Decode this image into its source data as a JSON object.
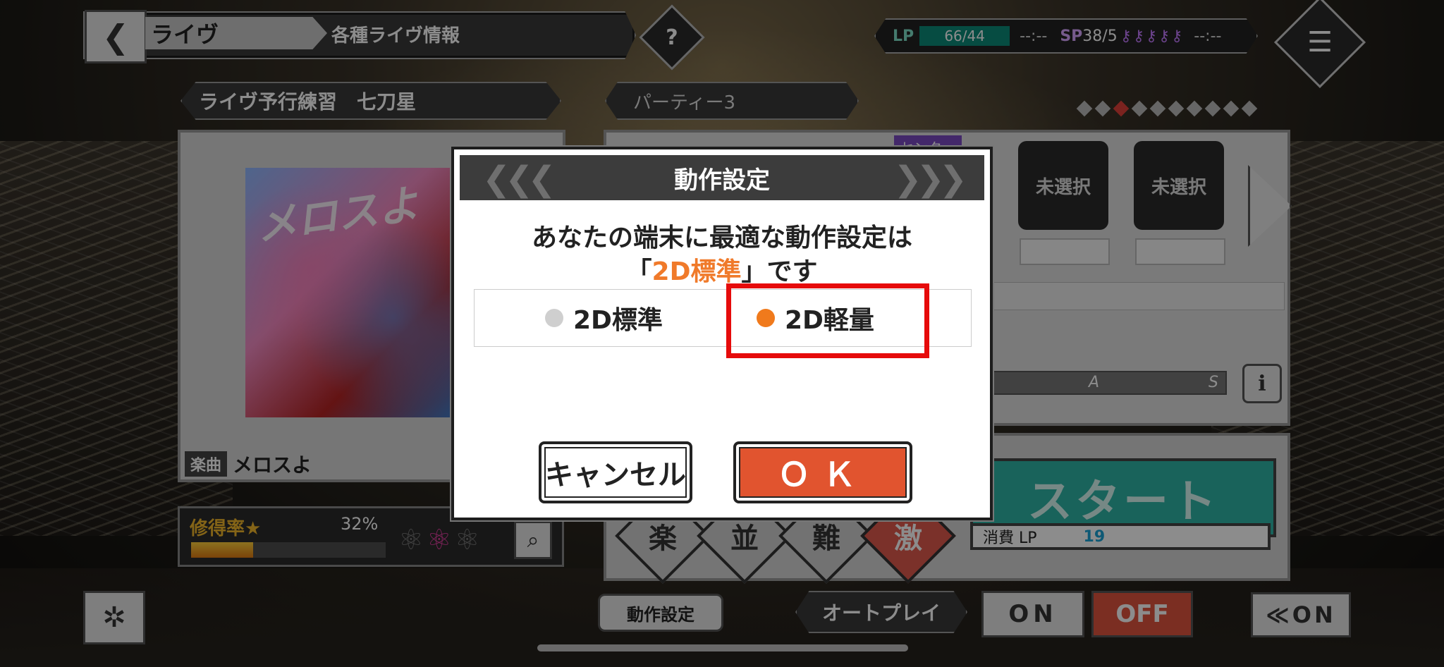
{
  "header": {
    "back_icon": "chevron-left-icon",
    "title": "ライヴ",
    "subtitle": "各種ライヴ情報",
    "help": "?",
    "menu_icon": "hamburger-icon"
  },
  "status": {
    "lp_label": "LP",
    "lp_value": "66/44",
    "lp_timer": "--:--",
    "sp_label": "SP",
    "sp_value": "38/5",
    "sp_keys": "⚷⚷⚷⚷⚷",
    "sp_timer": "--:--"
  },
  "live": {
    "song_bar": "ライヴ予行練習　七刀星",
    "party": "パーティー3",
    "song_tag": "楽曲",
    "song_name": "メロスよ",
    "jacket_text": "メロスよ"
  },
  "mastery": {
    "label": "修得率★",
    "percent": "32%",
    "progress": 0.32,
    "medals": "⚛",
    "medal_active": "⚛",
    "medals_after": "⚛"
  },
  "party_slots": {
    "center_tag": "センター",
    "slot4": "未選択",
    "slot5": "未選択"
  },
  "rank": {
    "a": "A",
    "s": "S",
    "info": "i"
  },
  "difficulty": [
    "楽",
    "並",
    "難",
    "激"
  ],
  "start": {
    "label": "スタート",
    "cost_label": "消費 LP",
    "cost_value": "19"
  },
  "footer": {
    "performance_settings": "動作設定",
    "autoplay_label": "オートプレイ",
    "on": "ON",
    "off": "OFF",
    "skip": "≪ON"
  },
  "dialog": {
    "title": "動作設定",
    "message_line1": "あなたの端末に最適な動作設定は",
    "message_open": "「",
    "message_highlight": "2D標準",
    "message_close": "」です",
    "option_standard": "2D標準",
    "option_light": "2D軽量",
    "selected": "2D軽量",
    "cancel": "キャンセル",
    "ok": "ＯＫ"
  },
  "colors": {
    "accent_orange": "#f07a1c",
    "ok_button": "#e1542f",
    "highlight_red": "#e60b0b",
    "start_teal": "#2fb4a6"
  }
}
